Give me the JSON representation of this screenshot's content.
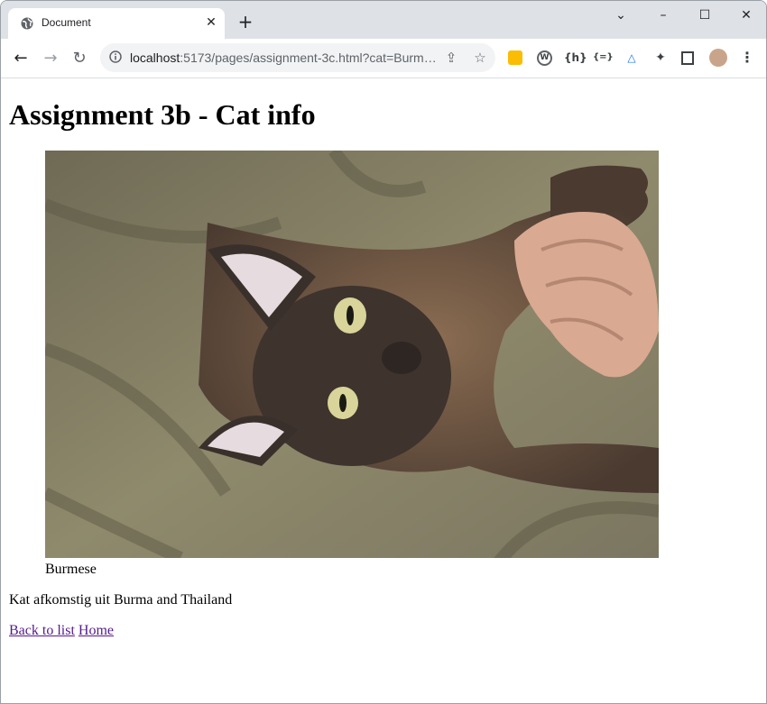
{
  "browser": {
    "tab_title": "Document",
    "url_host": "localhost",
    "url_rest": ":5173/pages/assignment-3c.html?cat=Burm…",
    "window_controls": [
      "chevron-down-icon",
      "minimize-icon",
      "maximize-icon",
      "close-icon"
    ],
    "extensions": [
      "keep-icon",
      "wordpress-icon",
      "hashnode-icon",
      "json-viewer-icon",
      "azure-icon",
      "extensions-puzzle-icon",
      "side-panel-icon",
      "profile-avatar"
    ]
  },
  "page": {
    "heading": "Assignment 3b - Cat info",
    "figure_caption": "Burmese",
    "description": "Kat afkomstig uit Burma and Thailand",
    "links": {
      "back": "Back to list",
      "home": "Home"
    }
  },
  "colors": {
    "titlebar": "#dee1e6",
    "link_visited": "#551a8b"
  }
}
